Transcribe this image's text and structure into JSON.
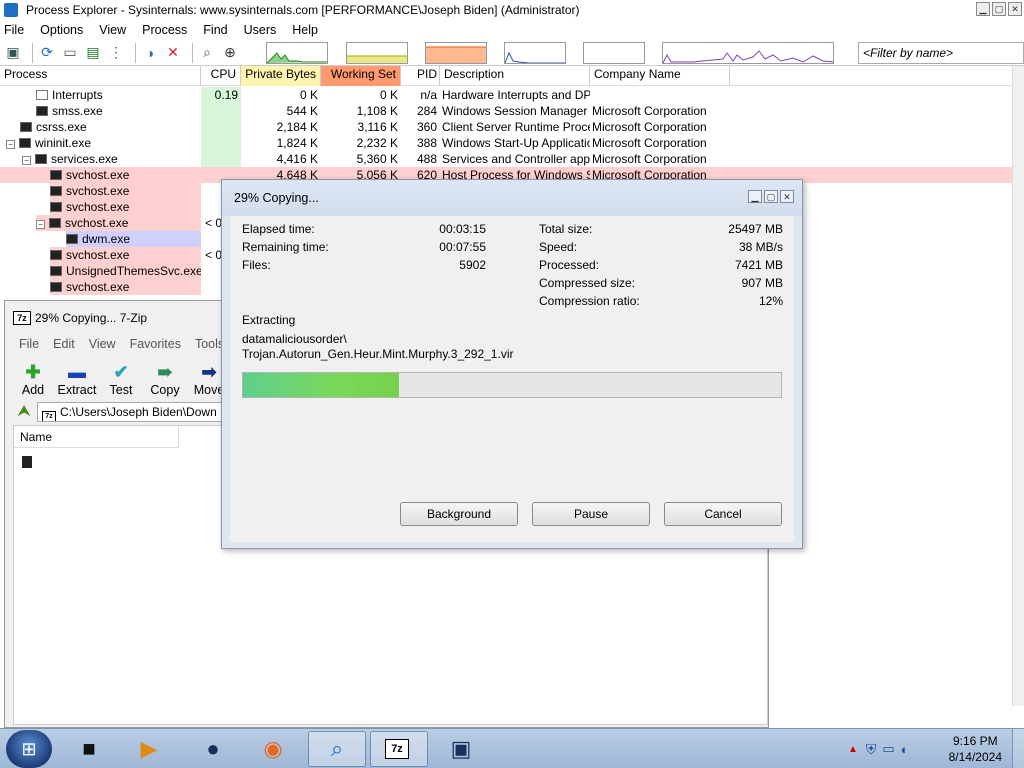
{
  "process_explorer": {
    "title": "Process Explorer - Sysinternals: www.sysinternals.com [PERFORMANCE\\Joseph Biden] (Administrator)",
    "menu": [
      "File",
      "Options",
      "View",
      "Process",
      "Find",
      "Users",
      "Help"
    ],
    "filter_placeholder": "<Filter by name>",
    "columns": {
      "process": "Process",
      "cpu": "CPU",
      "private_bytes": "Private Bytes",
      "working_set": "Working Set",
      "pid": "PID",
      "description": "Description",
      "company": "Company Name"
    },
    "rows": [
      {
        "name": "Interrupts",
        "cpu": "0.19",
        "private": "0 K",
        "working": "0 K",
        "pid": "n/a",
        "desc": "Hardware Interrupts and DPCs",
        "company": ""
      },
      {
        "name": "smss.exe",
        "cpu": "",
        "private": "544 K",
        "working": "1,108 K",
        "pid": "284",
        "desc": "Windows Session Manager",
        "company": "Microsoft Corporation"
      },
      {
        "name": "csrss.exe",
        "cpu": "",
        "private": "2,184 K",
        "working": "3,116 K",
        "pid": "360",
        "desc": "Client Server Runtime Process",
        "company": "Microsoft Corporation"
      },
      {
        "name": "wininit.exe",
        "cpu": "",
        "private": "1,824 K",
        "working": "2,232 K",
        "pid": "388",
        "desc": "Windows Start-Up Application",
        "company": "Microsoft Corporation"
      },
      {
        "name": "services.exe",
        "cpu": "",
        "private": "4,416 K",
        "working": "5,360 K",
        "pid": "488",
        "desc": "Services and Controller app",
        "company": "Microsoft Corporation"
      },
      {
        "name": "svchost.exe",
        "cpu": "",
        "private": "4,648 K",
        "working": "5,056 K",
        "pid": "620",
        "desc": "Host Process for Windows S...",
        "company": "Microsoft Corporation"
      },
      {
        "name": "svchost.exe",
        "cpu": "",
        "private": "",
        "working": "",
        "pid": "",
        "desc": "",
        "company": ""
      },
      {
        "name": "svchost.exe",
        "cpu": "",
        "private": "",
        "working": "",
        "pid": "",
        "desc": "",
        "company": ""
      },
      {
        "name": "svchost.exe",
        "cpu": "< 0",
        "private": "",
        "working": "",
        "pid": "",
        "desc": "",
        "company": ""
      },
      {
        "name": "dwm.exe",
        "cpu": "",
        "private": "",
        "working": "",
        "pid": "",
        "desc": "",
        "company": ""
      },
      {
        "name": "svchost.exe",
        "cpu": "< 0",
        "private": "",
        "working": "",
        "pid": "",
        "desc": "",
        "company": ""
      },
      {
        "name": "UnsignedThemesSvc.exe",
        "cpu": "",
        "private": "",
        "working": "",
        "pid": "",
        "desc": "",
        "company": ""
      },
      {
        "name": "svchost.exe",
        "cpu": "",
        "private": "",
        "working": "",
        "pid": "",
        "desc": "",
        "company": ""
      }
    ]
  },
  "sevenzip": {
    "title": "29% Copying... 7-Zip",
    "menu": [
      "File",
      "Edit",
      "View",
      "Favorites",
      "Tools"
    ],
    "toolbar": [
      "Add",
      "Extract",
      "Test",
      "Copy",
      "Move"
    ],
    "address": "C:\\Users\\Joseph Biden\\Down",
    "list_header": "Name"
  },
  "dialog": {
    "title": "29% Copying...",
    "elapsed_label": "Elapsed time:",
    "elapsed_value": "00:03:15",
    "remaining_label": "Remaining time:",
    "remaining_value": "00:07:55",
    "files_label": "Files:",
    "files_value": "5902",
    "total_label": "Total size:",
    "total_value": "25497 MB",
    "speed_label": "Speed:",
    "speed_value": "38 MB/s",
    "processed_label": "Processed:",
    "processed_value": "7421 MB",
    "compressed_label": "Compressed size:",
    "compressed_value": "907 MB",
    "ratio_label": "Compression ratio:",
    "ratio_value": "12%",
    "operation": "Extracting",
    "path_line1": "datamaliciousorder\\",
    "path_line2": "Trojan.Autorun_Gen.Heur.Mint.Murphy.3_292_1.vir",
    "progress_fraction": 0.29,
    "buttons": {
      "background": "Background",
      "pause": "Pause",
      "cancel": "Cancel"
    }
  },
  "taskbar": {
    "time": "9:16 PM",
    "date": "8/14/2024"
  },
  "colors": {
    "private_header": "#fff3b0",
    "working_header": "#ff9a70",
    "service_row": "#ffd0d0",
    "selected_row": "#d0d0ff",
    "progress": "#76d04a"
  }
}
